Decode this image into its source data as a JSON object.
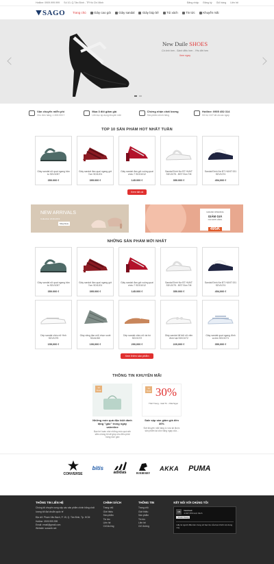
{
  "topbar": {
    "left": [
      "Hotline: 0909.999.999",
      "Số 10, Q.Tân Bình - TP.Hồ Chí Minh"
    ],
    "right": [
      "Đăng nhập",
      "Đăng ký",
      "Giỏ hàng",
      "Liên hệ"
    ]
  },
  "header": {
    "logo": "SAGO",
    "nav": [
      {
        "label": "Trang chủ"
      },
      {
        "label": "Giày cao gót"
      },
      {
        "label": "Giày sandal"
      },
      {
        "label": "Giày búp bê"
      },
      {
        "label": "Túi xách"
      },
      {
        "label": "Tin tức"
      },
      {
        "label": "Khuyến mãi"
      }
    ]
  },
  "hero": {
    "title_a": "New Duile ",
    "title_b": "SHOES",
    "subtitle": "Cá tính hơn - Sành điệu hơn - Yêu đời hơn",
    "link": "Xem ngay"
  },
  "features": [
    {
      "title": "Vận chuyển miễn phí",
      "sub": "Cho đơn hàng >=300.000 ₫"
    },
    {
      "title": "Mua 3 đôi giảm giá",
      "sub": "Liên tục áp dụng khuyến mãi"
    },
    {
      "title": "Chứng nhận chất lượng",
      "sub": "Sản phẩm chính hãng"
    },
    {
      "title": "Hotline: 0905 452 314",
      "sub": "Hỗ trợ 24/7 tất cả các ngày"
    }
  ],
  "top10": {
    "title": "TOP 10 SẢN PHẨM HOT NHẤT TUẦN",
    "items": [
      {
        "name": "Giày sandal nữ quai ngang bản to SDV1057",
        "price": "350.000 ₫"
      },
      {
        "name": "Giày sandal đan quai ngang gót 7cm SDI1201",
        "price": "395.000 ₫"
      },
      {
        "name": "Giày sandal đan gót vuông quai chéo 7 SDG1012",
        "price": "145.000 ₫"
      },
      {
        "name": "Sandal Đính Nơ BT HUNT SDV1075 - BST Đón Tết",
        "price": "350.000 ₫"
      },
      {
        "name": "Sandal Đính Nơ BT HUNT 001 SDV1074",
        "price": "454,000 ₫"
      }
    ],
    "button": "Xem tất cả"
  },
  "banners": {
    "left_title": "NEW ARRIVALS",
    "left_sub": "Collection 2018-2019",
    "left_btn": "Shop Now",
    "right_top": "GRAND OPENING",
    "right_mid": "GIẢM GIÁ",
    "right_small": "CHO ĐƠN HÀNG",
    "right_price": "495K"
  },
  "newest": {
    "title": "NHỮNG SẢN PHẨM MỚI NHẤT",
    "row1": [
      {
        "name": "Giày sandal nữ quai ngang bản to SDV1057",
        "price": "350.000 ₫"
      },
      {
        "name": "Giày sandal đan quai ngang gót 7cm SDI1201",
        "price": "395.000 ₫"
      },
      {
        "name": "Giày sandal đan gót vuông quai chéo 7 SDG1012",
        "price": "145.000 ₫"
      },
      {
        "name": "Sandal Đính Nơ BT HUNT SDV1075 - BST Đón Tết",
        "price": "350.000 ₫"
      },
      {
        "name": "Sandal Đính Nơ BT HUNT 001 SDV1074",
        "price": "454,000 ₫"
      }
    ],
    "row2": [
      {
        "name": "Dép sandal chéo nữ Hnh SDV1075",
        "price": "159,000 ₫"
      },
      {
        "name": "Giày xăng đan mũi nhọn scott SDA1052",
        "price": "199,000 ₫"
      },
      {
        "name": "Dép sandal chéo nữ da bò SDV1072",
        "price": "290,000 ₫"
      },
      {
        "name": "Giày sandal đế bệt nữ viền đính hạt SDV1072",
        "price": "220,000 ₫"
      },
      {
        "name": "Giày sandal quai ngang đính cườm SDV1071",
        "price": "350,000 ₫"
      }
    ],
    "button": "Xem thêm sản phẩm"
  },
  "promo": {
    "title": "THÔNG TIN KHUYẾN MÃI",
    "items": [
      {
        "date": "14 Th02",
        "title": "Những món quà đặc biệt dành tặng \"gấu\" trong ngày valentine",
        "desc": "Bạn bè hoàn nhớ những món quà sến sẩm chúng tôi sẽ giúp cho điều phải 'nàng nào' gần"
      },
      {
        "date": "14 Th02",
        "big": "30%",
        "small": "Thời Trang - Giải Trí - Nhà Ngọc",
        "title": "Sale sập sàn giảm giá đến 30%",
        "desc": "Đợt khuyến mãi hàng lo vừa lại được sản phẩm tại cửa hàng ngay của..."
      }
    ]
  },
  "brands": [
    "CONVERSE",
    "bitis",
    "adidas",
    "BURBERRY",
    "AKKA",
    "PUMA"
  ],
  "footer": {
    "contact_title": "THÔNG TIN LIÊN HỆ",
    "contact_lines": [
      "Chúng tôi chuyên cung cấp các sản phẩm chính hãng chất lượng tốt đạt chuẩn quốc tế",
      "Địa chỉ: Phạm Văn Bạch, P. 15, Q. Tân Bình, Tp. HCM",
      "Hotline: 0909.999.999",
      "Email: email@gmail.com",
      "Website: sosweb.net"
    ],
    "policy_title": "CHÍNH SÁCH",
    "policy_items": [
      "Trang chủ",
      "Giới thiệu",
      "Sản phẩm",
      "Tin tức",
      "Liên hệ",
      "Chỉ đường"
    ],
    "info_title": "THÔNG TIN",
    "info_items": [
      "Trang chủ",
      "Giới thiệu",
      "Sản phẩm",
      "Tin tức",
      "Liên hệ",
      "Chỉ đường"
    ],
    "social_title": "KẾT NỐI VỚI CHÚNG TÔI",
    "fb_name": "facebook",
    "fb_likes": "4.637.876 lượt thích",
    "fb_btn": "Thích Trang",
    "fb_note": "Hãy là người đầu tiên trong số bạn bè của bạn thích nội dung này"
  }
}
